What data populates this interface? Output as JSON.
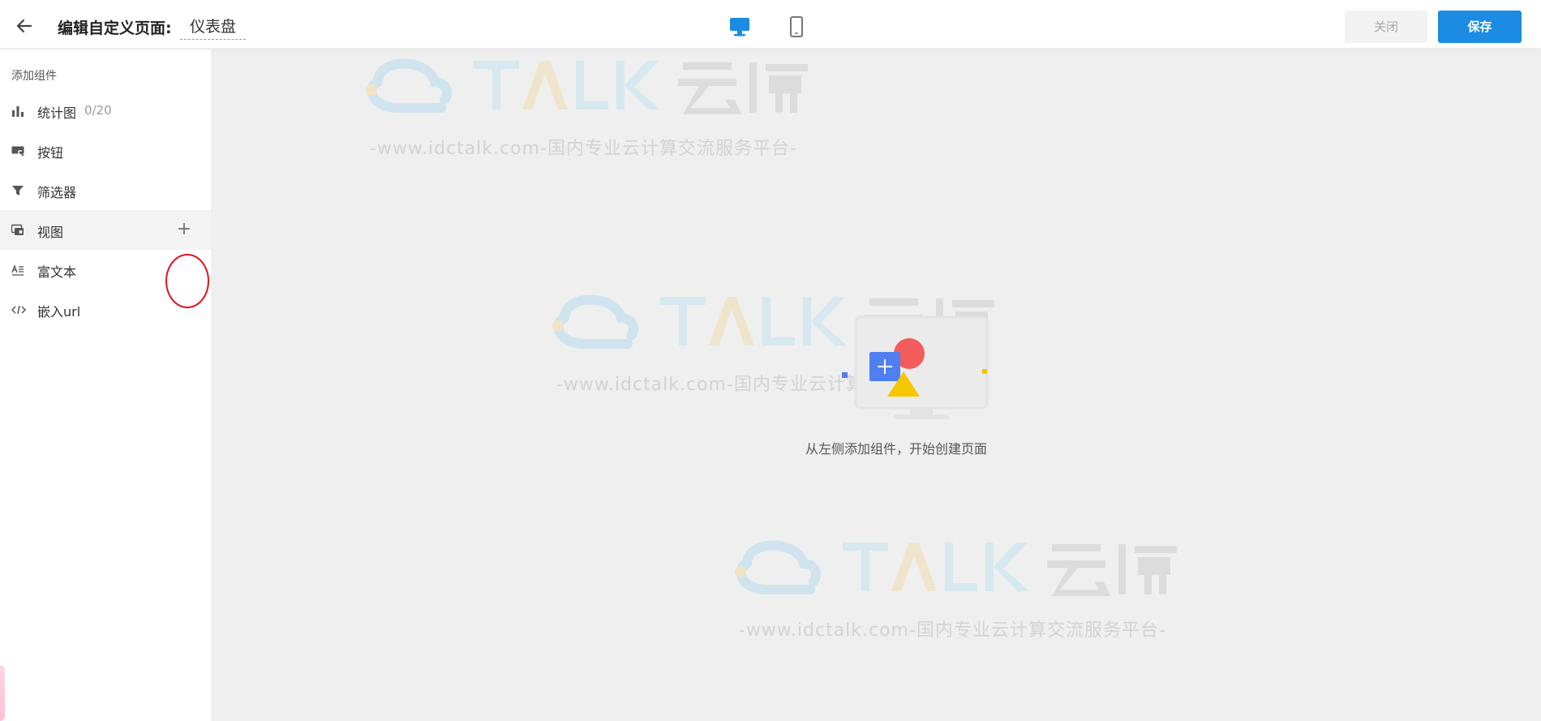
{
  "header": {
    "title_label": "编辑自定义页面:",
    "page_name": "仪表盘",
    "close_label": "关闭",
    "save_label": "保存",
    "device_icons": [
      "desktop-icon",
      "mobile-icon"
    ],
    "active_device": "desktop"
  },
  "sidebar": {
    "heading": "添加组件",
    "items": [
      {
        "label": "统计图",
        "count": "0/20",
        "icon": "bar-chart-icon"
      },
      {
        "label": "按钮",
        "icon": "button-icon"
      },
      {
        "label": "筛选器",
        "icon": "filter-icon"
      },
      {
        "label": "视图",
        "icon": "view-icon",
        "add": "+"
      },
      {
        "label": "富文本",
        "icon": "rich-text-icon"
      },
      {
        "label": "嵌入url",
        "icon": "embed-code-icon"
      }
    ]
  },
  "canvas": {
    "empty_text": "从左侧添加组件，开始创建页面",
    "watermark_url": "-www.idctalk.com-国内专业云计算交流服务平台-"
  },
  "colors": {
    "primary": "#1b8be3",
    "canvas_bg": "#efefef",
    "highlight_circle": "#e0141e"
  }
}
